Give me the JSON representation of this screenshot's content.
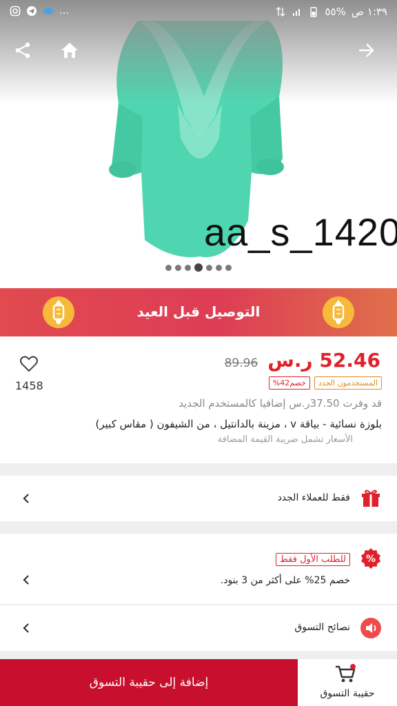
{
  "status_bar": {
    "time": "١:٣٩ ص",
    "battery": "%٥٥"
  },
  "product_image": {
    "watermark": "aa_s_1420",
    "slide_count": 7,
    "active_slide": 3
  },
  "banner": {
    "title": "التوصيل قبل العيد"
  },
  "price_card": {
    "price": "52.46 ر.س",
    "old_price": "89.96",
    "tag_new_users": "المستخدمون الجدد",
    "tag_discount": "خصم42%",
    "save_text": "قد وفرت 37.50ر.س إضافيا كالمستخدم الجديد",
    "product_name": "بلوزة نسائية - بياقة v ، مزينة بالدانتيل ، من الشيفون ( مقاس كبير)",
    "vat_text": "الأسعار تشمل ضريبة القيمة المضافة",
    "likes": "1458"
  },
  "rows": {
    "new_customers": "فقط للعملاء الجدد",
    "first_order_badge": "للطلب الأول فقط",
    "first_order_text": "خصم 25%  على أكثر من 3 بنود.",
    "shopping_tips": "نصائح التسوق"
  },
  "bottom_bar": {
    "add_to_bag": "إضافة إلى حقيبة التسوق",
    "bag": "حقيبة التسوق"
  },
  "colors": {
    "accent_red": "#e0202a",
    "button_red": "#c8102e",
    "shirt_mint": "#4fd6b0"
  }
}
